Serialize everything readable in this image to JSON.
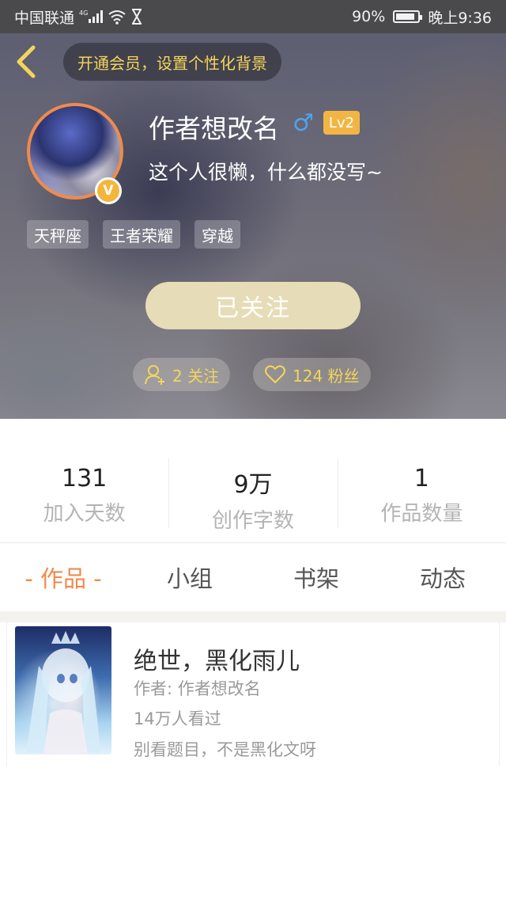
{
  "status_bar": {
    "carrier": "中国联通",
    "network": "4G",
    "battery": "90%",
    "battery_level": 0.9,
    "time": "晚上9:36"
  },
  "header": {
    "vip_banner": "开通会员，设置个性化背景",
    "username": "作者想改名",
    "gender_symbol": "♂",
    "level": "Lv2",
    "verified_badge": "V",
    "bio": "这个人很懒，什么都没写~",
    "tags": [
      "天秤座",
      "王者荣耀",
      "穿越"
    ],
    "follow_button": "已关注",
    "following_label": "2 关注",
    "followers_label": "124 粉丝",
    "accent_color": "#f3d55a"
  },
  "stats": [
    {
      "value": "131",
      "label": "加入天数"
    },
    {
      "value": "9万",
      "label": "创作字数"
    },
    {
      "value": "1",
      "label": "作品数量"
    }
  ],
  "tabs": [
    {
      "label": "- 作品 -",
      "active": true
    },
    {
      "label": "小组",
      "active": false
    },
    {
      "label": "书架",
      "active": false
    },
    {
      "label": "动态",
      "active": false
    }
  ],
  "works": [
    {
      "title": "绝世，黑化雨儿",
      "author": "作者: 作者想改名",
      "views": "14万人看过",
      "description": "别看题目，不是黑化文呀"
    }
  ]
}
